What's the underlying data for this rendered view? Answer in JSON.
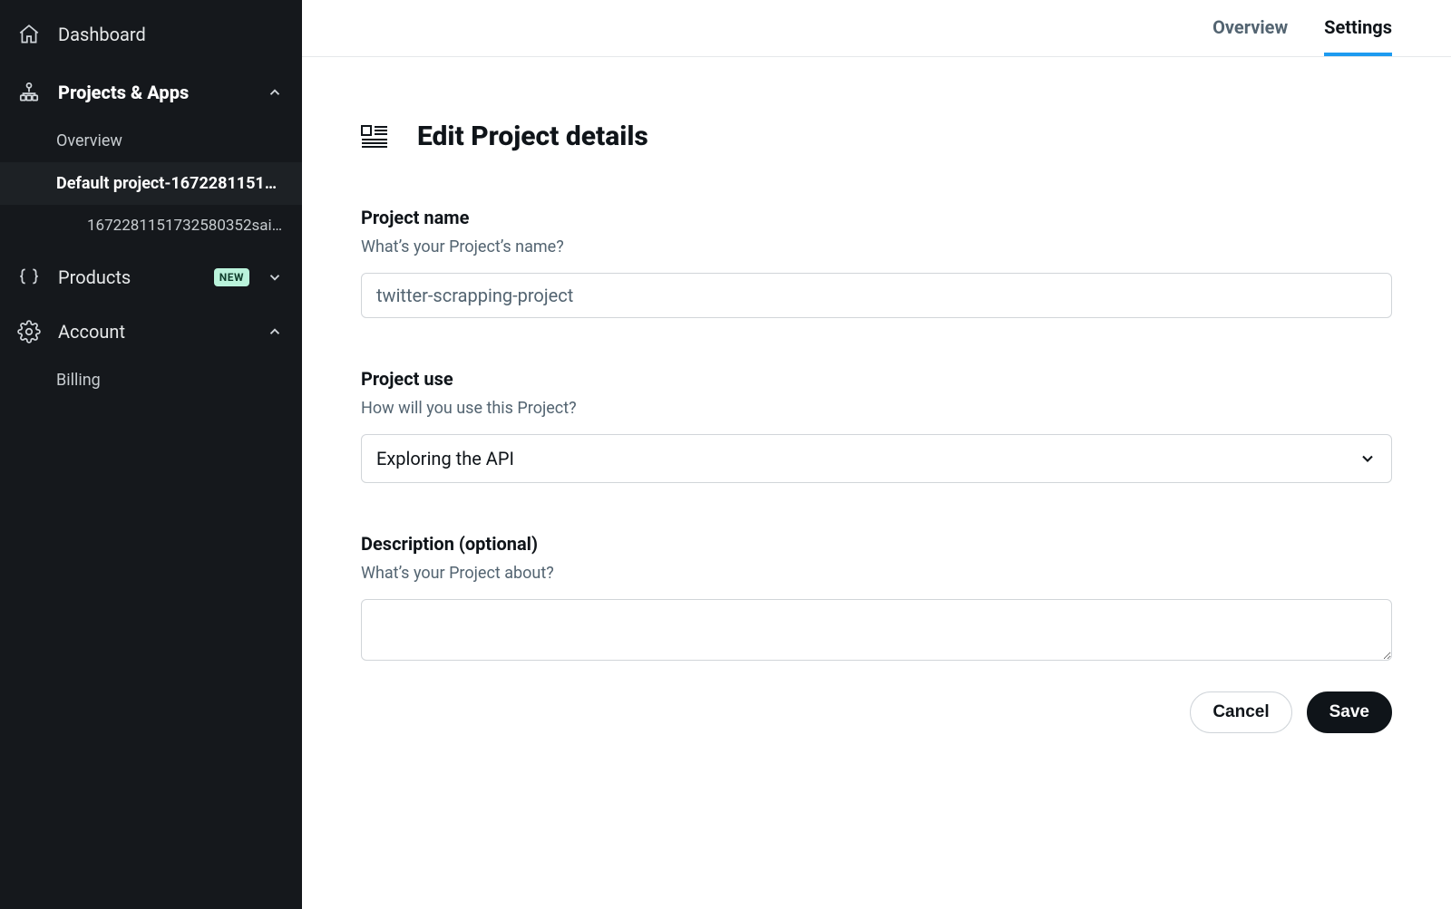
{
  "sidebar": {
    "dashboard_label": "Dashboard",
    "projects_label": "Projects & Apps",
    "projects_overview_label": "Overview",
    "project_active_label": "Default project-16722811517...",
    "app_label": "1672281151732580352sai...",
    "products_label": "Products",
    "products_badge": "NEW",
    "account_label": "Account",
    "billing_label": "Billing"
  },
  "tabs": {
    "overview": "Overview",
    "settings": "Settings"
  },
  "page": {
    "title": "Edit Project details"
  },
  "form": {
    "name_label": "Project name",
    "name_sub": "What’s your Project’s name?",
    "name_value": "twitter-scrapping-project",
    "use_label": "Project use",
    "use_sub": "How will you use this Project?",
    "use_value": "Exploring the API",
    "desc_label": "Description (optional)",
    "desc_sub": "What’s your Project about?",
    "desc_value": "",
    "cancel_label": "Cancel",
    "save_label": "Save"
  }
}
